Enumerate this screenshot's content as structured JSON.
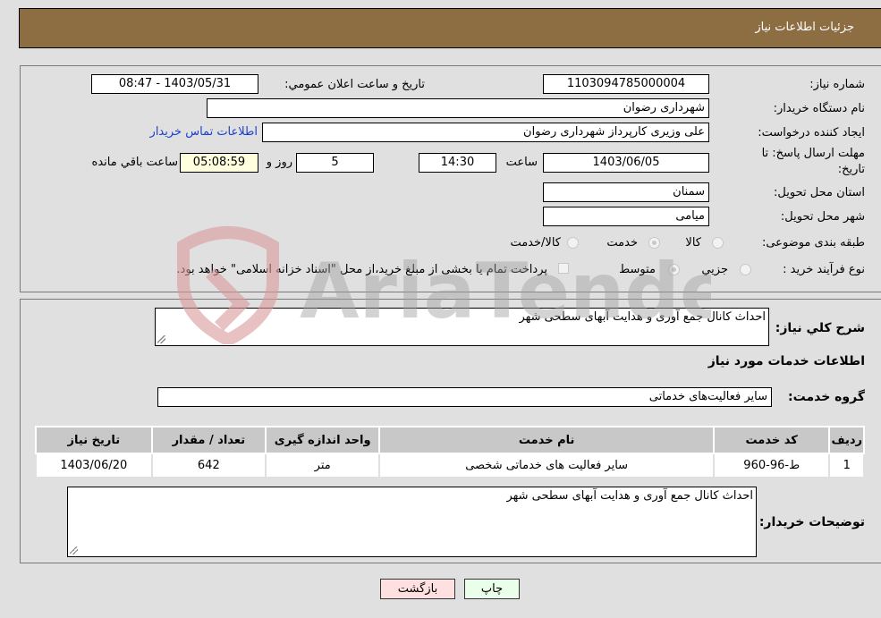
{
  "header": {
    "title": "جزئیات اطلاعات نیاز"
  },
  "fields": {
    "need_number_label": "شماره نیاز:",
    "need_number": "1103094785000004",
    "announce_label": "تاریخ و ساعت اعلان عمومي:",
    "announce_value": "1403/05/31 - 08:47",
    "buyer_org_label": "نام دستگاه خریدار:",
    "buyer_org": "شهرداری رضوان",
    "creator_label": "ایجاد کننده درخواست:",
    "creator": "علی وزیری کارپرداز شهرداری رضوان",
    "contact_link": "اطلاعات تماس خریدار",
    "deadline_label_1": "مهلت ارسال پاسخ: تا",
    "deadline_label_2": "تاریخ:",
    "deadline_date": "1403/06/05",
    "time_label": "ساعت",
    "deadline_time": "14:30",
    "days_value": "5",
    "days_label": "روز و",
    "remaining_time": "05:08:59",
    "remaining_label": "ساعت باقي مانده",
    "province_label": "استان محل تحویل:",
    "province": "سمنان",
    "city_label": "شهر محل تحویل:",
    "city": "میامی",
    "category_label": "طبقه بندی موضوعی:",
    "category_options": [
      "کالا",
      "خدمت",
      "کالا/خدمت"
    ],
    "category_selected": "خدمت",
    "process_label": "نوع فرآیند خرید :",
    "process_options": [
      "جزيي",
      "متوسط"
    ],
    "process_selected": "متوسط",
    "treasury_note": "پرداخت تمام یا بخشی از مبلغ خرید،از محل \"اسناد خزانه اسلامی\" خواهد بود."
  },
  "details": {
    "summary_label": "شرح کلي نیاز:",
    "summary": "احداث کانال جمع آوری و هدایت آبهای سطحی شهر",
    "services_heading": "اطلاعات خدمات مورد نیاز",
    "service_group_label": "گروه خدمت:",
    "service_group": "سایر فعالیت‌های خدماتی",
    "table": {
      "headers": [
        "ردیف",
        "کد خدمت",
        "نام خدمت",
        "واحد اندازه گیری",
        "تعداد / مقدار",
        "تاریخ نیاز"
      ],
      "rows": [
        [
          "1",
          "ط-96-960",
          "سایر فعالیت های خدماتی شخصی",
          "متر",
          "642",
          "1403/06/20"
        ]
      ]
    },
    "buyer_notes_label": "توضیحات خریدار:",
    "buyer_notes": "احداث کانال جمع آوری و هدایت آبهای سطحی شهر"
  },
  "buttons": {
    "print": "چاپ",
    "back": "بازگشت"
  },
  "watermark": "AriaTender.neT",
  "colors": {
    "header_bg": "#8d6d42",
    "print_bg": "#eaffea",
    "back_bg": "#ffe0e0",
    "link": "#1a3fd0"
  }
}
